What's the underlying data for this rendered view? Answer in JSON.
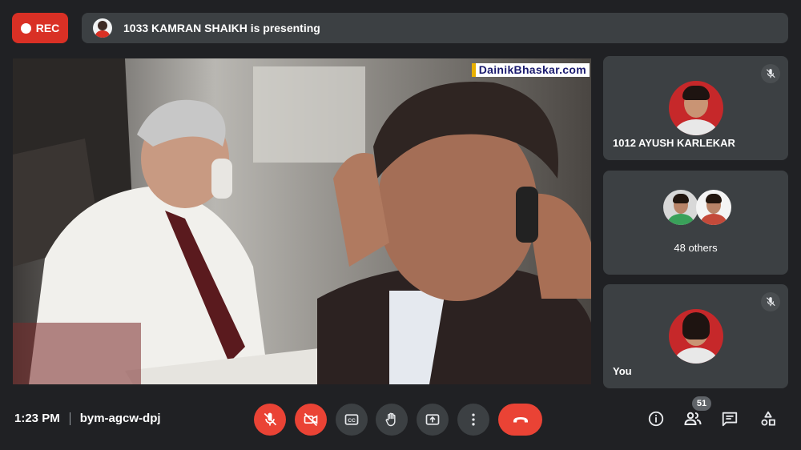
{
  "top": {
    "rec_label": "REC",
    "presenting_text": "1033 KAMRAN SHAIKH is presenting"
  },
  "presentation": {
    "watermark": "DainikBhaskar.com"
  },
  "tiles": [
    {
      "name": "1012 AYUSH KARLEKAR",
      "muted": true
    },
    {
      "name": "48 others"
    },
    {
      "name": "You",
      "muted": true
    }
  ],
  "bottom": {
    "time": "1:23 PM",
    "meeting_code": "bym-agcw-dpj",
    "participant_count": "51"
  },
  "colors": {
    "background": "#202124",
    "surface": "#3c4043",
    "danger": "#ea4335",
    "rec": "#d93025"
  },
  "icons": [
    "mic-off-icon",
    "camera-off-icon",
    "captions-icon",
    "raise-hand-icon",
    "present-screen-icon",
    "more-options-icon",
    "end-call-icon",
    "info-icon",
    "people-icon",
    "chat-icon",
    "activities-icon"
  ]
}
